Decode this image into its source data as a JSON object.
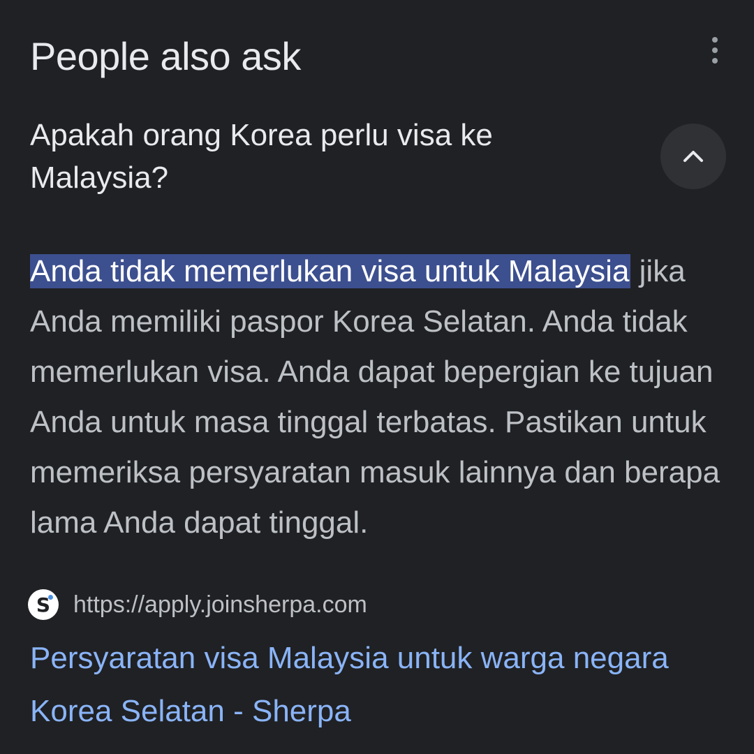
{
  "section": {
    "title": "People also ask",
    "more_icon": "more-vert-icon"
  },
  "question": {
    "text": "Apakah orang Korea perlu visa ke Malaysia?",
    "toggle_icon": "chevron-up-icon"
  },
  "answer": {
    "highlight": "Anda tidak memerlukan visa untuk Malaysia",
    "body": " jika Anda memiliki paspor Korea Selatan. Anda tidak memerlukan visa. Anda dapat bepergian ke tujuan Anda untuk masa tinggal terbatas. Pastikan untuk memeriksa persyaratan masuk lainnya dan berapa lama Anda dapat tinggal."
  },
  "source": {
    "favicon_letter": "S",
    "url": "https://apply.joinsherpa.com"
  },
  "result": {
    "title": "Persyaratan visa Malaysia untuk warga negara Korea Selatan - Sherpa"
  },
  "colors": {
    "background": "#202124",
    "highlight": "#3c4f8f",
    "link": "#8ab4f8",
    "button_bg": "#303134"
  }
}
